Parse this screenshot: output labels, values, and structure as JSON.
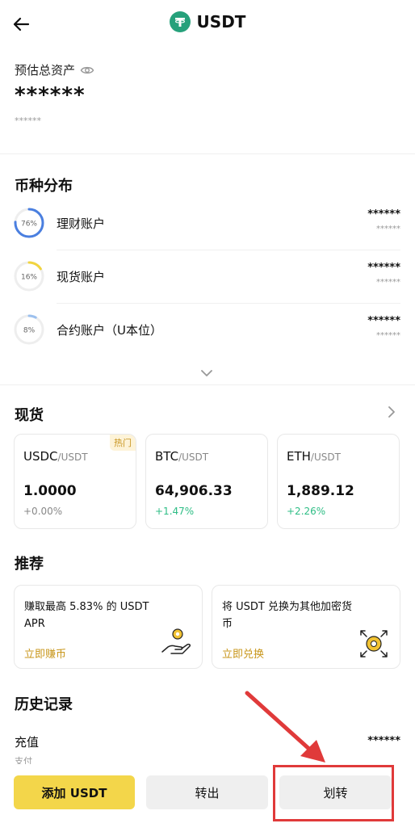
{
  "header": {
    "title": "USDT",
    "back_icon": "arrow-left-icon",
    "coin_icon": "tether-logo-icon",
    "coin_color": "#26a17b"
  },
  "assets": {
    "label": "预估总资产",
    "value": "******",
    "sub_value": "******",
    "eye_icon": "eye-icon"
  },
  "distribution": {
    "title": "币种分布",
    "items": [
      {
        "name": "理财账户",
        "percent_label": "76%",
        "percent": 76,
        "color": "#4a7fe0",
        "value": "******",
        "sub_value": "******"
      },
      {
        "name": "现货账户",
        "percent_label": "16%",
        "percent": 16,
        "color": "#f1d43f",
        "value": "******",
        "sub_value": "******"
      },
      {
        "name": "合约账户（U本位）",
        "percent_label": "8%",
        "percent": 8,
        "color": "#9cc0ee",
        "value": "******",
        "sub_value": "******"
      }
    ]
  },
  "spot": {
    "title": "现货",
    "hot_label": "热门",
    "cards": [
      {
        "base": "USDC",
        "quote": "/USDT",
        "price": "1.0000",
        "change": "+0.00%",
        "change_color": "#888888"
      },
      {
        "base": "BTC",
        "quote": "/USDT",
        "price": "64,906.33",
        "change": "+1.47%",
        "change_color": "#2ebd85"
      },
      {
        "base": "ETH",
        "quote": "/USDT",
        "price": "1,889.12",
        "change": "+2.26%",
        "change_color": "#2ebd85"
      }
    ]
  },
  "recommend": {
    "title": "推荐",
    "cards": [
      {
        "text": "赚取最高 5.83% 的 USDT APR",
        "link": "立即赚币",
        "icon": "hand-coin-icon"
      },
      {
        "text": "将 USDT 兑换为其他加密货币",
        "link": "立即兑换",
        "icon": "convert-coin-icon"
      }
    ]
  },
  "history": {
    "title": "历史记录",
    "item_label": "充值",
    "item_sub": "支付",
    "item_value": "******"
  },
  "actions": {
    "add": "添加 USDT",
    "withdraw": "转出",
    "transfer": "划转"
  },
  "colors": {
    "accent_yellow": "#f3d64a",
    "link_gold": "#c8961a",
    "annotation_red": "#e03a3a"
  }
}
